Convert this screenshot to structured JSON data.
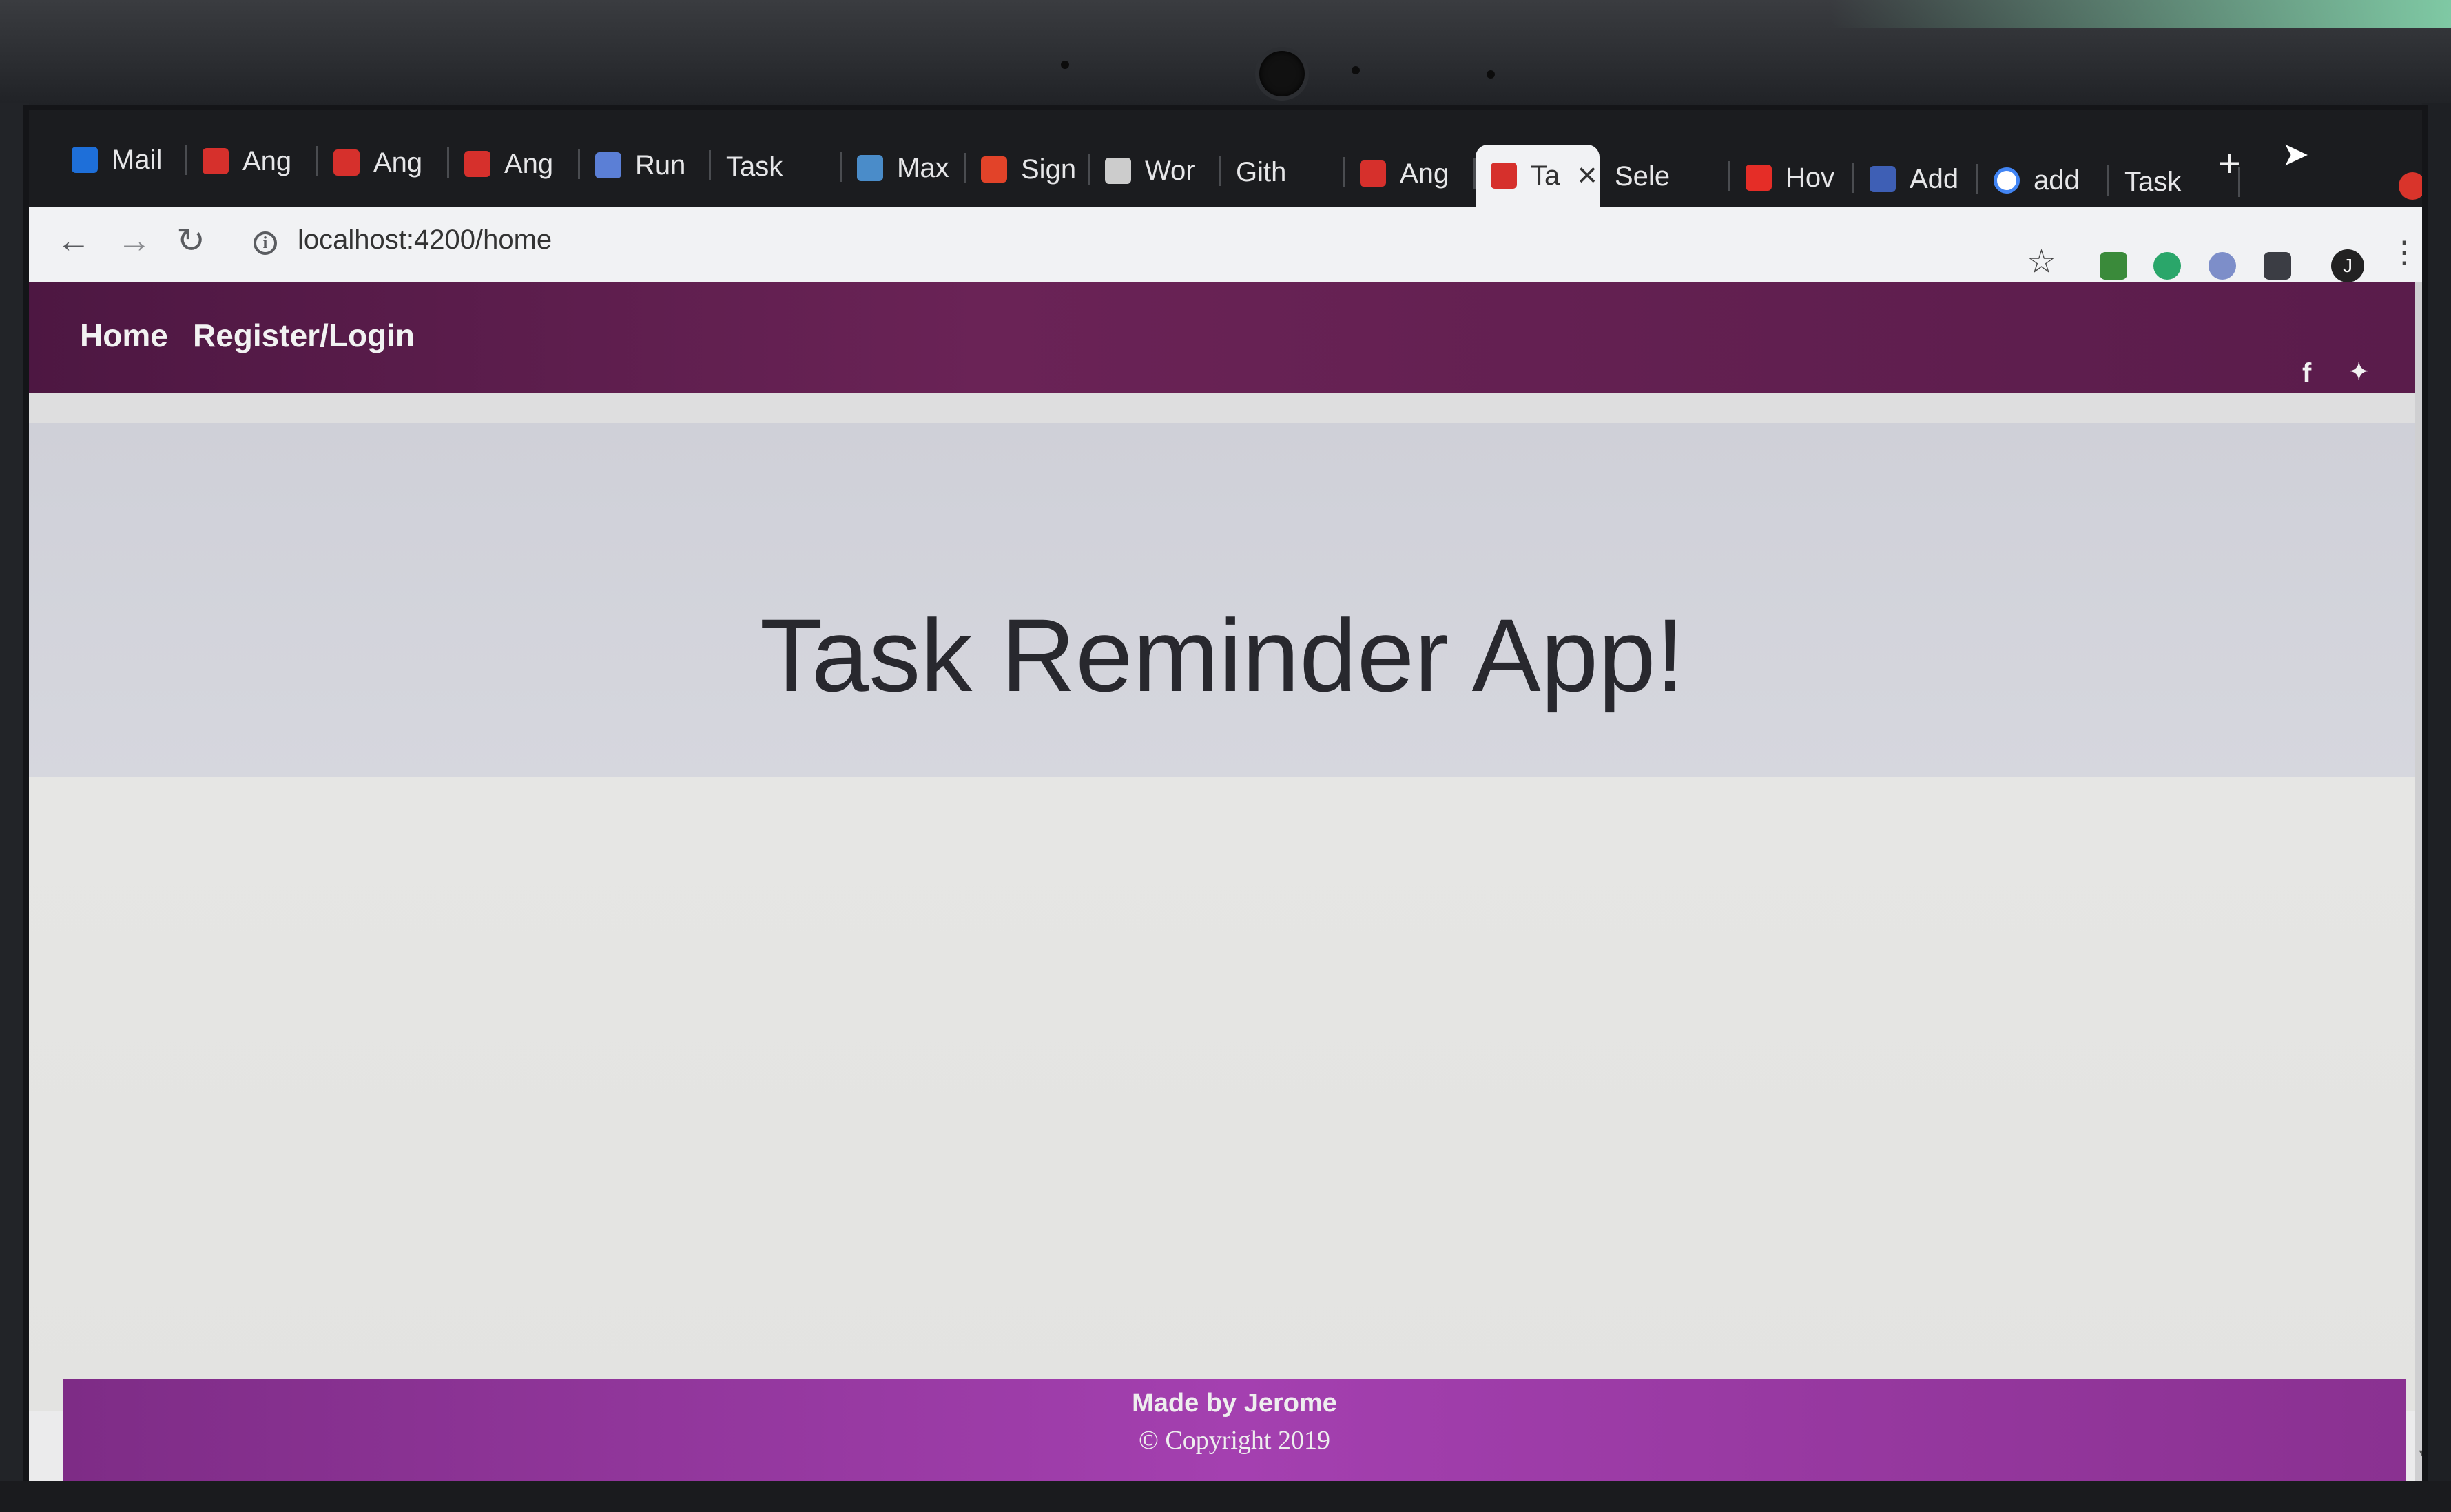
{
  "browser": {
    "tabs": [
      {
        "label": "Mail",
        "icon": "outlook-icon",
        "color": "#1e6fd9"
      },
      {
        "label": "Ang",
        "icon": "angular-icon",
        "color": "#d6302c"
      },
      {
        "label": "Ang",
        "icon": "angular-icon",
        "color": "#d6302c"
      },
      {
        "label": "Ang",
        "icon": "angular-icon",
        "color": "#d6302c"
      },
      {
        "label": "Run",
        "icon": "runner-icon",
        "color": "#5b7fd6"
      },
      {
        "label": "Task",
        "icon": "",
        "color": ""
      },
      {
        "label": "Max",
        "icon": "s-icon",
        "color": "#4a8cc9"
      },
      {
        "label": "Sign",
        "icon": "gitlab-icon",
        "color": "#e24329"
      },
      {
        "label": "Wor",
        "icon": "wordpress-icon",
        "color": "#cccccc"
      },
      {
        "label": "Gith",
        "icon": "",
        "color": ""
      },
      {
        "label": "Ang",
        "icon": "angular-icon",
        "color": "#d6302c"
      },
      {
        "label": "Ta",
        "icon": "angular-icon",
        "color": "#d6302c",
        "active": true
      },
      {
        "label": "Sele",
        "icon": "",
        "color": ""
      },
      {
        "label": "Hov",
        "icon": "youtube-icon",
        "color": "#e52d27"
      },
      {
        "label": "Add",
        "icon": "ext-icon",
        "color": "#3e5fb5"
      },
      {
        "label": "add",
        "icon": "google-icon",
        "color": "#ffffff"
      },
      {
        "label": "Task",
        "icon": "",
        "color": ""
      }
    ],
    "new_tab_label": "+",
    "close_tab_label": "✕",
    "url": "localhost:4200/home",
    "info_icon_label": "i",
    "back_icon": "←",
    "forward_icon": "→",
    "reload_icon": "↻",
    "bookmark_icon": "☆",
    "profile_initial": "J",
    "menu_icon": "⋮"
  },
  "navbar": {
    "links": [
      "Home",
      "Register/Login"
    ],
    "social": {
      "facebook": "f",
      "twitter": "🐦"
    },
    "gradient_color": "#5a1c4b"
  },
  "hero": {
    "title": "Task Reminder App!"
  },
  "footer": {
    "made_by": "Made by Jerome",
    "copyright": "© Copyright 2019",
    "color": "#a440b0"
  }
}
